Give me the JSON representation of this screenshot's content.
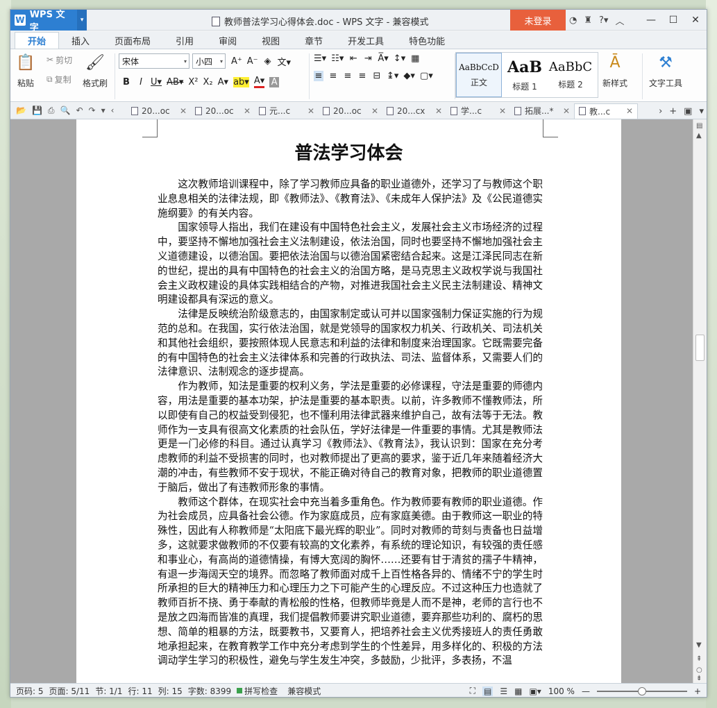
{
  "app": {
    "name": "WPS 文字"
  },
  "window_title": "教师普法学习心得体会.doc - WPS 文字 - 兼容模式",
  "login_label": "未登录",
  "ribbon_tabs": [
    "开始",
    "插入",
    "页面布局",
    "引用",
    "审阅",
    "视图",
    "章节",
    "开发工具",
    "特色功能"
  ],
  "clipboard": {
    "paste": "粘贴",
    "cut": "剪切",
    "copy": "复制",
    "format_painter": "格式刷"
  },
  "font": {
    "family": "宋体",
    "size": "小四"
  },
  "styles": [
    {
      "sample": "AaBbCcD",
      "label": "正文"
    },
    {
      "sample": "AaB",
      "label": "标题 1"
    },
    {
      "sample": "AaBbC",
      "label": "标题 2"
    }
  ],
  "new_style": "新样式",
  "text_tools": "文字工具",
  "doc_tabs": [
    "20...oc",
    "20...oc",
    "元...c",
    "20...oc",
    "20...cx",
    "学...c",
    "拓展...*",
    "教...c"
  ],
  "document": {
    "title": "普法学习体会",
    "paragraphs": [
      " 这次教师培训课程中，除了学习教师应具备的职业道德外，还学习了与教师这个职业息息相关的法律法规，即《教师法》、《教育法》、《未成年人保护法》及《公民道德实施纲要》的有关内容。",
      "国家领导人指出，我们在建设有中国特色社会主义，发展社会主义市场经济的过程中，要坚持不懈地加强社会主义法制建设，依法治国，同时也要坚持不懈地加强社会主义道德建设，以德治国。要把依法治国与以德治国紧密结合起来。这是江泽民同志在新的世纪，提出的具有中国特色的社会主义的治国方略，是马克思主义政权学说与我国社会主义政权建设的具体实践相结合的产物，对推进我国社会主义民主法制建设、精神文明建设都具有深远的意义。",
      "法律是反映统治阶级意志的，由国家制定或认可并以国家强制力保证实施的行为规范的总和。在我国，实行依法治国，就是党领导的国家权力机关、行政机关、司法机关和其他社会组织，要按照体现人民意志和利益的法律和制度来治理国家。它既需要完备的有中国特色的社会主义法律体系和完善的行政执法、司法、监督体系，又需要人们的法律意识、法制观念的逐步提高。",
      "作为教师，知法是重要的权利义务，学法是重要的必修课程，守法是重要的师德内容，用法是重要的基本功架，护法是重要的基本职责。以前，许多教师不懂教师法，所以即使有自己的权益受到侵犯，也不懂利用法律武器来维护自己，故有法等于无法。教师作为一支具有很高文化素质的社会队伍，学好法律是一件重要的事情。尤其是教师法更是一门必修的科目。通过认真学习《教师法》、《教育法》，我认识到：国家在充分考虑教师的利益不受损害的同时，也对教师提出了更高的要求，鉴于近几年来随着经济大潮的冲击，有些教师不安于现状，不能正确对待自己的教育对象，把教师的职业道德置于脑后，做出了有违教师形象的事情。",
      "教师这个群体，在现实社会中充当着多重角色。作为教师要有教师的职业道德。作为社会成员，应具备社会公德。作为家庭成员，应有家庭美德。由于教师这一职业的特殊性，因此有人称教师是“太阳底下最光辉的职业”。同时对教师的苛刻与责备也日益增多，这就要求做教师的不仅要有较高的文化素养，有系统的理论知识，有较强的责任感和事业心，有高尚的道德情操，有博大宽阔的胸怀……还要有甘于清贫的孺子牛精神，有退一步海阔天空的境界。而忽略了教师面对成千上百性格各异的、情绪不宁的学生时所承担的巨大的精神压力和心理压力之下可能产生的心理反应。不过这种压力也造就了教师百折不挠、勇于奉献的青松般的性格，但教师毕竟是人而不是神，老师的言行也不是放之四海而皆准的真理，我们提倡教师要讲究职业道德，要弃那些功利的、腐朽的思想、简单的粗暴的方法，既要教书，又要育人，把培养社会主义优秀接班人的责任勇敢地承担起来，在教育教学工作中充分考虑到学生的个性差异，用多样化的、积极的方法调动学生学习的积极性，避免与学生发生冲突，多鼓励，少批评，多表扬，不温"
    ]
  },
  "status": {
    "page_no": "页码: 5",
    "pages": "页面: 5/11",
    "section": "节: 1/1",
    "line": "行: 11",
    "column": "列: 15",
    "word_count": "字数: 8399",
    "spell_check": "拼写检查",
    "compat_mode": "兼容模式",
    "zoom": "100 %",
    "zoom_level": 0.5
  }
}
